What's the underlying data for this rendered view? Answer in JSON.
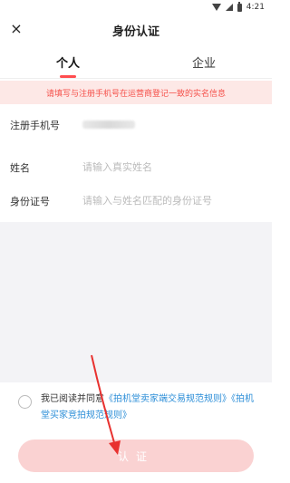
{
  "statusbar": {
    "time": "4:21"
  },
  "header": {
    "title": "身份认证",
    "close_icon": "×"
  },
  "tabs": [
    {
      "label": "个人",
      "active": true
    },
    {
      "label": "企业",
      "active": false
    }
  ],
  "notice": "请填写与注册手机号在运营商登记一致的实名信息",
  "form": {
    "phone_label": "注册手机号",
    "name_label": "姓名",
    "name_placeholder": "请输入真实姓名",
    "id_label": "身份证号",
    "id_placeholder": "请输入与姓名匹配的身份证号"
  },
  "agreement": {
    "prefix": "我已阅读并同意",
    "link1": "《拍机堂卖家端交易规范规则》",
    "link2": "《拍机堂买家竞拍规范规则》"
  },
  "submit_label": "认证",
  "colors": {
    "accent": "#ff4d4f",
    "notice_bg": "#fde8e6",
    "link": "#2e8fd8",
    "button_disabled": "#fad2d2",
    "annotation_arrow": "#e8312f"
  }
}
